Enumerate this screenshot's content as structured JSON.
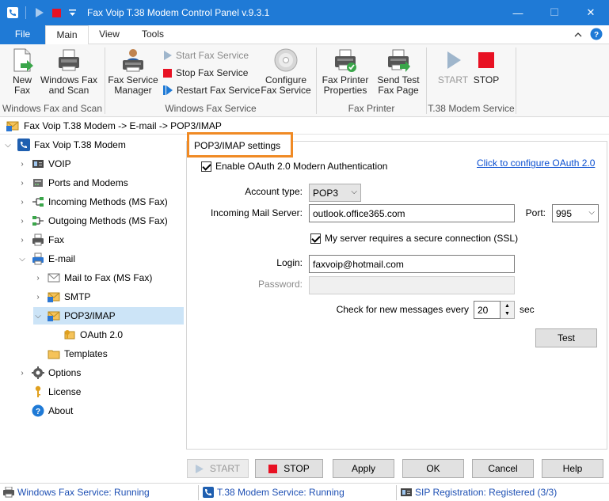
{
  "window": {
    "title": "Fax Voip T.38 Modem Control Panel v.9.3.1",
    "minimize_glyph": "—",
    "maximize_glyph": "☐",
    "close_glyph": "✕"
  },
  "ribbon_tabs": [
    {
      "label": "File"
    },
    {
      "label": "Main"
    },
    {
      "label": "View"
    },
    {
      "label": "Tools"
    }
  ],
  "ribbon": {
    "new_fax": {
      "line1": "New",
      "line2": "Fax"
    },
    "windows_fax_scan": {
      "line1": "Windows Fax",
      "line2": "and Scan"
    },
    "group_windows_fax_scan": "Windows Fax and Scan",
    "fax_service_manager": {
      "line1": "Fax Service",
      "line2": "Manager"
    },
    "start_fax_service": "Start Fax Service",
    "stop_fax_service": "Stop Fax Service",
    "restart_fax_service": "Restart Fax Service",
    "configure_fax_service": {
      "line1": "Configure",
      "line2": "Fax Service"
    },
    "group_windows_fax_service": "Windows Fax Service",
    "fax_printer_properties": {
      "line1": "Fax Printer",
      "line2": "Properties"
    },
    "send_test_fax_page": {
      "line1": "Send Test",
      "line2": "Fax Page"
    },
    "group_fax_printer": "Fax Printer",
    "start": "START",
    "stop": "STOP",
    "group_t38_modem_service": "T.38 Modem Service"
  },
  "breadcrumb": "Fax Voip T.38 Modem -> E-mail -> POP3/IMAP",
  "tree": {
    "root": "Fax Voip T.38 Modem",
    "voip": "VOIP",
    "ports_modems": "Ports and Modems",
    "incoming_methods": "Incoming Methods (MS Fax)",
    "outgoing_methods": "Outgoing Methods (MS Fax)",
    "fax": "Fax",
    "email": "E-mail",
    "mail_to_fax": "Mail to Fax (MS Fax)",
    "smtp": "SMTP",
    "pop3_imap": "POP3/IMAP",
    "oauth": "OAuth 2.0",
    "templates": "Templates",
    "options": "Options",
    "license": "License",
    "about": "About"
  },
  "settings": {
    "title": "POP3/IMAP settings",
    "enable_oauth": "Enable OAuth 2.0 Modern Authentication",
    "configure_oauth_link": "Click to configure OAuth 2.0",
    "account_type_label": "Account type:",
    "account_type_value": "POP3",
    "incoming_server_label": "Incoming Mail Server:",
    "incoming_server_value": "outlook.office365.com",
    "port_label": "Port:",
    "port_value": "995",
    "ssl_label": "My server requires a secure connection (SSL)",
    "login_label": "Login:",
    "login_value": "faxvoip@hotmail.com",
    "password_label": "Password:",
    "check_messages_label": "Check for new messages every",
    "check_interval_value": "20",
    "sec_label": "sec",
    "test_button": "Test"
  },
  "bottom_buttons": {
    "start": "START",
    "stop": "STOP",
    "apply": "Apply",
    "ok": "OK",
    "cancel": "Cancel",
    "help": "Help"
  },
  "statusbar": {
    "windows_fax": "Windows Fax Service: Running",
    "t38_modem": "T.38 Modem Service: Running",
    "sip_registration": "SIP Registration: Registered (3/3)"
  },
  "colors": {
    "accent": "#1f7ad6",
    "highlight_border": "#f08a24",
    "stop_red": "#e81123",
    "selection": "#cce4f7",
    "link": "#0b4fd0"
  }
}
